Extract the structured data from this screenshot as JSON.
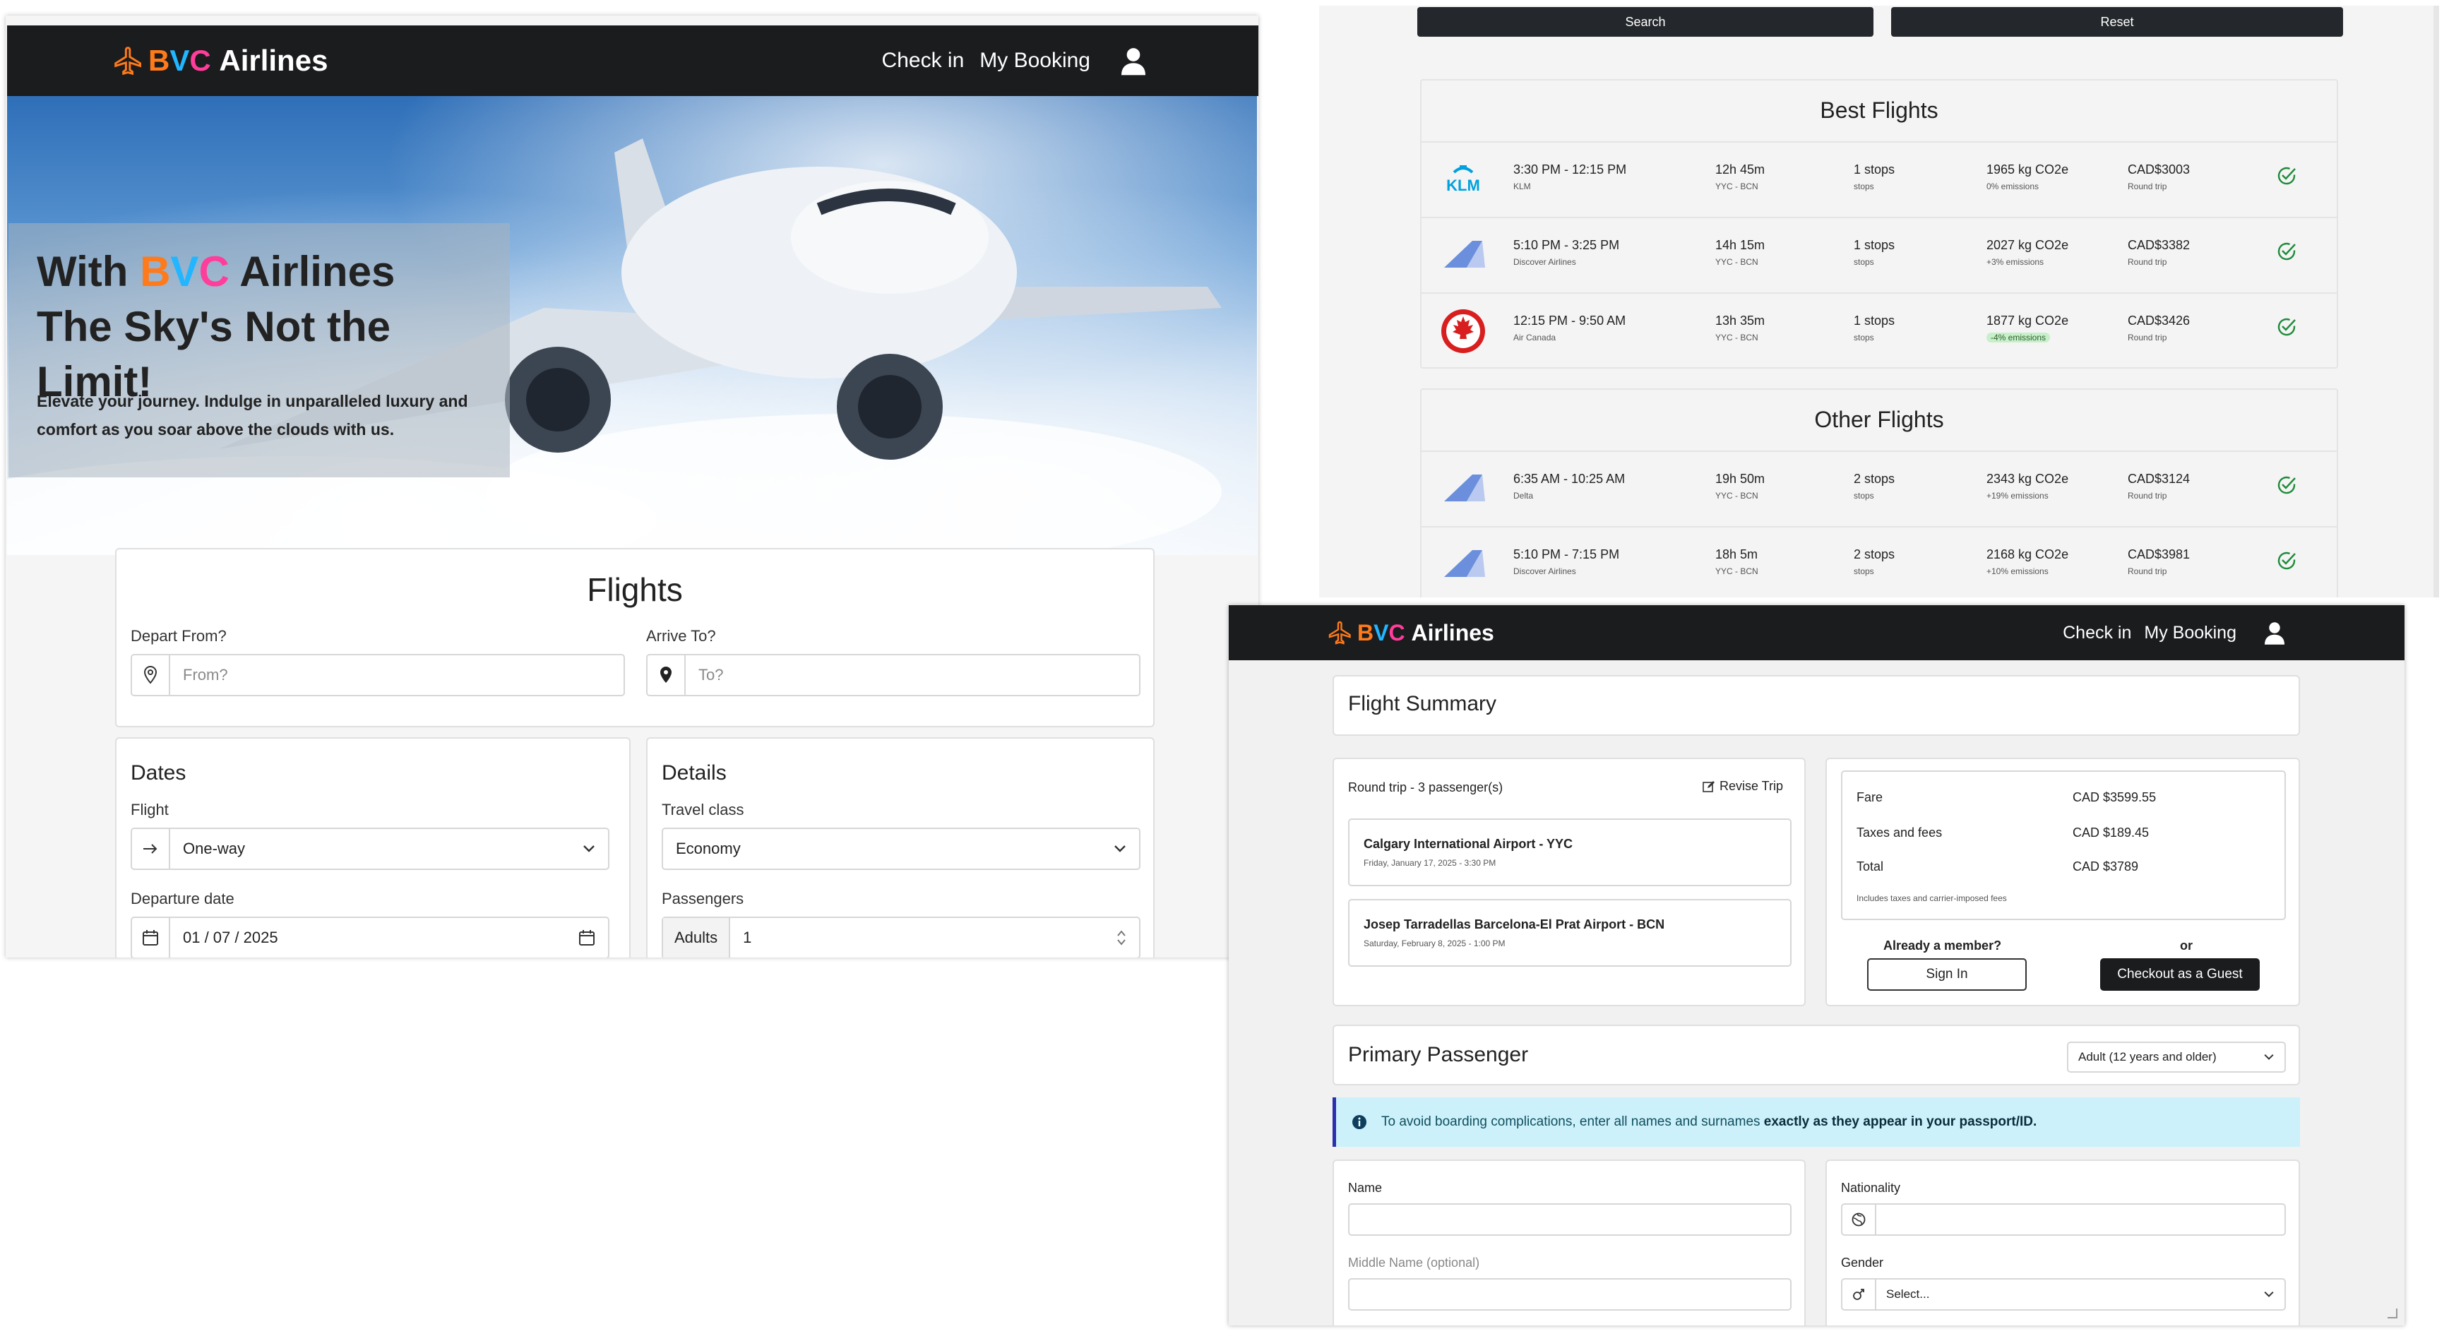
{
  "colors": {
    "navbar": "#1b1c1e",
    "brand_b": "#ff7a1a",
    "brand_v": "#21b6ff",
    "brand_c": "#ff3d9a",
    "check_green": "#1e8a3a",
    "air_canada_red": "#d81e1e",
    "klm_blue": "#00a1de"
  },
  "brand": {
    "b": "B",
    "v": "V",
    "c": "C",
    "rest": "Airlines",
    "icon": "plane-icon"
  },
  "nav": {
    "check_in": "Check in",
    "my_booking": "My Booking",
    "user_icon": "user-icon"
  },
  "home": {
    "hero": {
      "line1_pre": "With ",
      "line1_post": " Airlines",
      "line2": "The Sky's Not the Limit!",
      "subtitle": "Elevate your journey. Indulge in unparalleled luxury and comfort as you soar above the clouds with us."
    },
    "flights": {
      "title": "Flights",
      "depart_label": "Depart From?",
      "depart_placeholder": "From?",
      "arrive_label": "Arrive To?",
      "arrive_placeholder": "To?"
    },
    "dates": {
      "title": "Dates",
      "flight_label": "Flight",
      "flight_value": "One-way",
      "departure_label": "Departure date",
      "departure_value": "01 / 07 / 2025"
    },
    "details": {
      "title": "Details",
      "class_label": "Travel class",
      "class_value": "Economy",
      "passengers_label": "Passengers",
      "adults_label": "Adults",
      "adults_value": "1"
    }
  },
  "results": {
    "search_button": "Search",
    "reset_button": "Reset",
    "best": {
      "title": "Best Flights",
      "flights": [
        {
          "logo": "klm-logo",
          "logo_text": "KLM",
          "time": "3:30 PM - 12:15 PM",
          "airline": "KLM",
          "duration": "12h 45m",
          "route": "YYC - BCN",
          "stops": "1 stops",
          "stops_label": "stops",
          "co2": "1965 kg CO2e",
          "emissions": "0% emissions",
          "price": "CAD$3003",
          "trip": "Round trip"
        },
        {
          "logo": "generic-airline-logo",
          "logo_text": "",
          "time": "5:10 PM - 3:25 PM",
          "airline": "Discover Airlines",
          "duration": "14h 15m",
          "route": "YYC - BCN",
          "stops": "1 stops",
          "stops_label": "stops",
          "co2": "2027 kg CO2e",
          "emissions": "+3% emissions",
          "price": "CAD$3382",
          "trip": "Round trip"
        },
        {
          "logo": "air-canada-logo",
          "logo_text": "",
          "time": "12:15 PM - 9:50 AM",
          "airline": "Air Canada",
          "duration": "13h 35m",
          "route": "YYC - BCN",
          "stops": "1 stops",
          "stops_label": "stops",
          "co2": "1877 kg CO2e",
          "emissions": "-4% emissions",
          "price": "CAD$3426",
          "trip": "Round trip"
        }
      ]
    },
    "other": {
      "title": "Other Flights",
      "flights": [
        {
          "logo": "generic-airline-logo",
          "time": "6:35 AM - 10:25 AM",
          "airline": "Delta",
          "duration": "19h 50m",
          "route": "YYC - BCN",
          "stops": "2 stops",
          "stops_label": "stops",
          "co2": "2343 kg CO2e",
          "emissions": "+19% emissions",
          "price": "CAD$3124",
          "trip": "Round trip"
        },
        {
          "logo": "generic-airline-logo",
          "time": "5:10 PM - 7:15 PM",
          "airline": "Discover Airlines",
          "duration": "18h 5m",
          "route": "YYC - BCN",
          "stops": "2 stops",
          "stops_label": "stops",
          "co2": "2168 kg CO2e",
          "emissions": "+10% emissions",
          "price": "CAD$3981",
          "trip": "Round trip"
        }
      ]
    }
  },
  "booking": {
    "summary_title": "Flight Summary",
    "trip": {
      "label": "Round trip - 3 passenger(s)",
      "revise": "Revise Trip"
    },
    "legs": [
      {
        "airport": "Calgary International Airport - YYC",
        "date": "Friday, January 17, 2025 - 3:30 PM"
      },
      {
        "airport": "Josep Tarradellas Barcelona-El Prat Airport - BCN",
        "date": "Saturday, February 8, 2025 - 1:00 PM"
      }
    ],
    "fare": {
      "fare_label": "Fare",
      "fare_value": "CAD $3599.55",
      "taxes_label": "Taxes and fees",
      "taxes_value": "CAD $189.45",
      "total_label": "Total",
      "total_value": "CAD $3789",
      "note": "Includes taxes and carrier-imposed fees"
    },
    "member": {
      "question": "Already a member?",
      "or": "or",
      "sign_in": "Sign In",
      "guest": "Checkout as a Guest"
    },
    "primary": {
      "title": "Primary Passenger",
      "age_value": "Adult (12 years and older)"
    },
    "alert": {
      "pre": "To avoid boarding complications, enter all names and surnames ",
      "bold": "exactly as they appear in your passport/ID."
    },
    "form": {
      "name_label": "Name",
      "middle_label": "Middle Name (optional)",
      "nationality_label": "Nationality",
      "gender_label": "Gender",
      "gender_value": "Select..."
    }
  }
}
